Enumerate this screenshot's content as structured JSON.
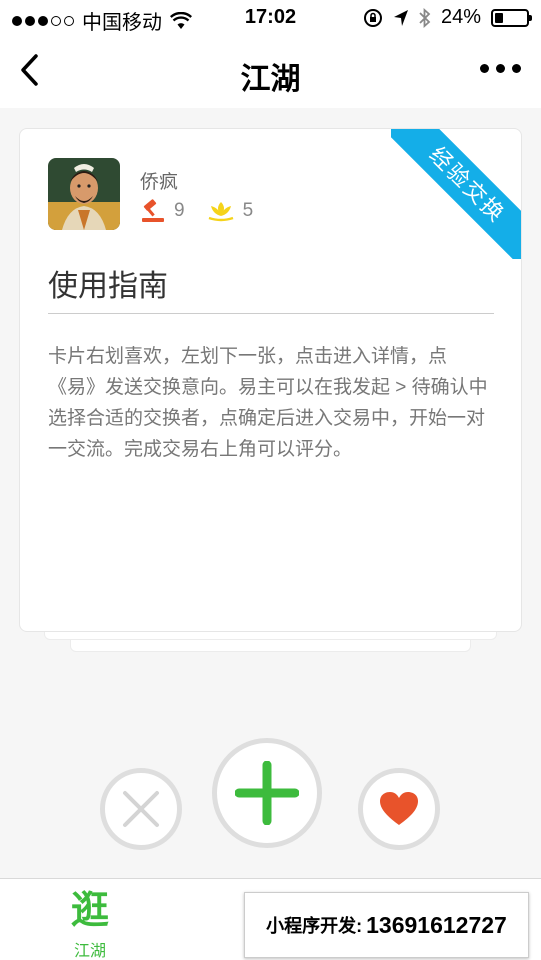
{
  "status_bar": {
    "carrier": "中国移动",
    "time": "17:02",
    "battery": "24%",
    "battery_level": 0.24
  },
  "nav": {
    "title": "江湖",
    "back_icon": "chevron-left-icon",
    "more_icon": "more-dots-icon"
  },
  "card": {
    "ribbon": "经验交换",
    "username": "侨疯",
    "stats": [
      {
        "icon": "gavel-icon",
        "value": "9",
        "color": "#e8532b"
      },
      {
        "icon": "lotus-icon",
        "value": "5",
        "color": "#f5d31a"
      }
    ],
    "title": "使用指南",
    "body": "卡片右划喜欢，左划下一张，点击进入详情，点《易》发送交换意向。易主可以在我发起 > 待确认中 选择合适的交换者，点确定后进入交易中，开始一对一交流。完成交易右上角可以评分。"
  },
  "actions": {
    "dislike_icon": "close-icon",
    "add_icon": "plus-icon",
    "like_icon": "heart-icon",
    "add_color": "#3dbb3d",
    "like_color": "#e8532b"
  },
  "tabbar": {
    "tab_icon": "逛",
    "tab_label": "江湖"
  },
  "promo": {
    "label": "小程序开发:",
    "phone": "13691612727"
  }
}
